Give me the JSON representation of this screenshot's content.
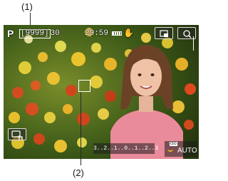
{
  "callouts": {
    "top": "(1)",
    "bottom": "(2)"
  },
  "osd": {
    "mode": "P",
    "shots_remaining": "[9999]",
    "shots_suffix": "30",
    "recording_time": "29:59",
    "level_indicator": "3..2..1..0..1..2..3",
    "iso_label": "ISO",
    "iso_value": "AUTO"
  },
  "icons": {
    "battery": "battery-icon",
    "stabilizer": "hand-shake-icon",
    "magnify": "magnify-icon",
    "info": "info-display-icon",
    "touch_shutter": "touch-shutter-icon"
  },
  "colors": {
    "iso_accent": "#f3b21a",
    "osd_text": "#ffffff"
  }
}
